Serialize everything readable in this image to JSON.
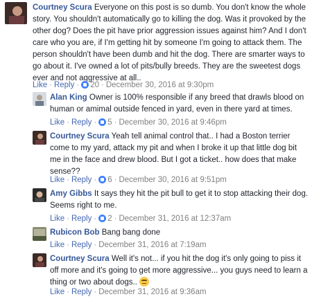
{
  "ui": {
    "like": "Like",
    "reply": "Reply",
    "separator": "·"
  },
  "comments": [
    {
      "author": "Courtney Scura",
      "text": "Everyone on this post is so dumb. You don't know the whole story. You shouldn't automatically go to killing the dog. Was it provoked by the other dog? Does the pit have prior aggression issues against him? And I don't care who you are, if I'm getting hit by someone I'm going to attack them. The person shouldn't have been dumb and hit the dog. There are smarter ways to go about it. I've owned a lot of pits/bully breeds. They are the sweetest dogs ever and not aggressive at all..",
      "likes": "20",
      "timestamp": "December 30, 2016 at 9:30pm"
    },
    {
      "author": "Alan King",
      "text": "Owner is 100% responsible if any breed that drawls blood on human or amimal outside fenced in yard, even in there yard at times.",
      "likes": "5",
      "timestamp": "December 30, 2016 at 9:46pm"
    },
    {
      "author": "Courtney Scura",
      "text": "Yeah tell animal control that.. I had a Boston terrier come to my yard, attack my pit and when I broke it up that little dog bit me in the face and drew blood. But I got a ticket.. how does that make sense??",
      "likes": "6",
      "timestamp": "December 30, 2016 at 9:51pm"
    },
    {
      "author": "Amy Gibbs",
      "text": "It says they hit the pit bull to get it to stop attacking their dog. Seems right to me.",
      "likes": "2",
      "timestamp": "December 31, 2016 at 12:37am"
    },
    {
      "author": "Rubicon Bob",
      "text": "Bang bang done",
      "likes": "",
      "timestamp": "December 31, 2016 at 7:19am"
    },
    {
      "author": "Courtney Scura",
      "text": "Well it's not... if you hit the dog it's only going to piss it off more and it's going to get more aggressive... you guys need to learn a thing or two about dogs..",
      "likes": "",
      "timestamp": "December 31, 2016 at 9:36am",
      "emoji": "unamused-face-emoji"
    }
  ]
}
